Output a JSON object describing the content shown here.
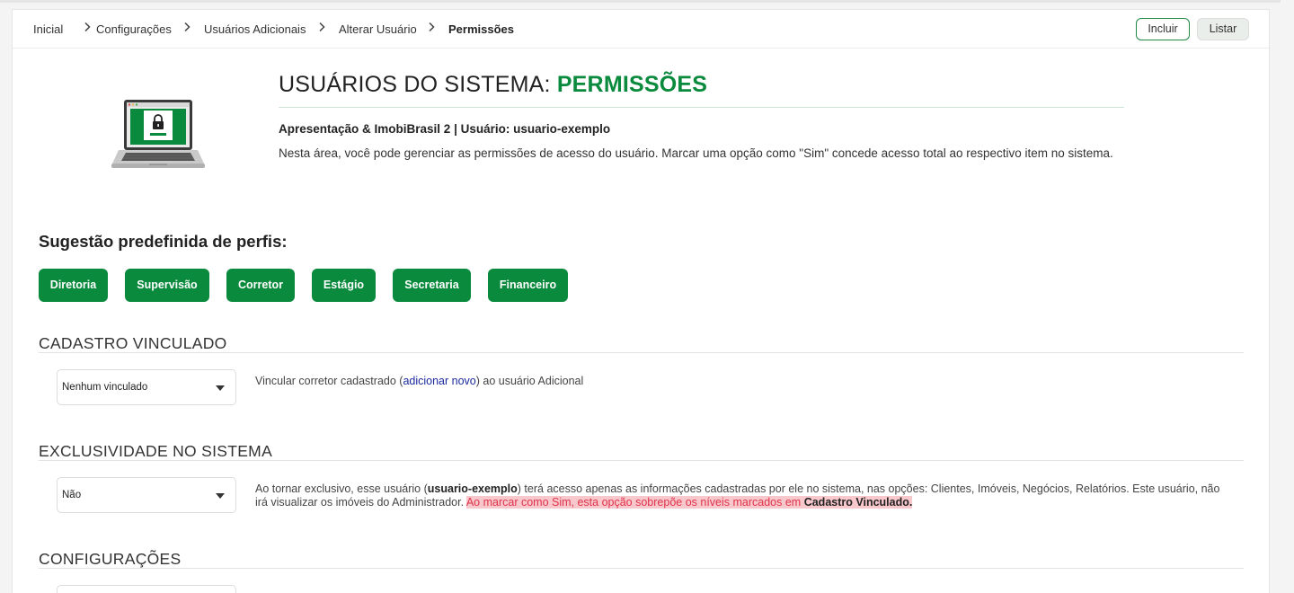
{
  "breadcrumb": {
    "items": [
      "Inicial",
      "Configurações",
      "Usuários Adicionais",
      "Alterar Usuário",
      "Permissões"
    ],
    "separator": ">"
  },
  "toolbar": {
    "incluir_label": "Incluir",
    "listar_label": "Listar"
  },
  "header": {
    "title_prefix": "USUÁRIOS DO SISTEMA: ",
    "title_highlight": "PERMISSÕES",
    "subtitle": "Apresentação & ImobiBrasil 2 | Usuário: usuario-exemplo",
    "description": "Nesta área, você pode gerenciar as permissões de acesso do usuário. Marcar uma opção como \"Sim\" concede acesso total ao respectivo item no sistema."
  },
  "suggestions": {
    "title": "Sugestão predefinida de perfis:",
    "profiles": [
      "Diretoria",
      "Supervisão",
      "Corretor",
      "Estágio",
      "Secretaria",
      "Financeiro"
    ]
  },
  "cadastro": {
    "title": "CADASTRO VINCULADO",
    "select_value": "Nenhum vinculado",
    "help_before": "Vincular corretor cadastrado (",
    "help_link": "adicionar novo",
    "help_after": ") ao usuário Adicional"
  },
  "exclusividade": {
    "title": "EXCLUSIVIDADE NO SISTEMA",
    "select_value": "Não",
    "help_1": "Ao tornar exclusivo, esse usuário (",
    "help_user": "usuario-exemplo",
    "help_2": ") terá acesso apenas as informações cadastradas por ele no sistema, nas opções: Clientes, Imóveis, Negócios, Relatórios. Este usuário, não irá visualizar os imóveis do Administrador. ",
    "help_warning": "Ao marcar como Sim, esta opção sobrepõe os níveis marcados em ",
    "help_warning_bold": "Cadastro Vinculado."
  },
  "configuracoes": {
    "title": "CONFIGURAÇÕES"
  },
  "colors": {
    "brand_green": "#0a8a3c",
    "warning_bg": "#f8c8cc",
    "warning_text": "#e0334a",
    "link": "#1a2a9e"
  },
  "icons": {
    "illustration": "laptop-lock-icon",
    "breadcrumb_sep": "chevron-right-icon",
    "select_caret": "caret-down-icon"
  }
}
